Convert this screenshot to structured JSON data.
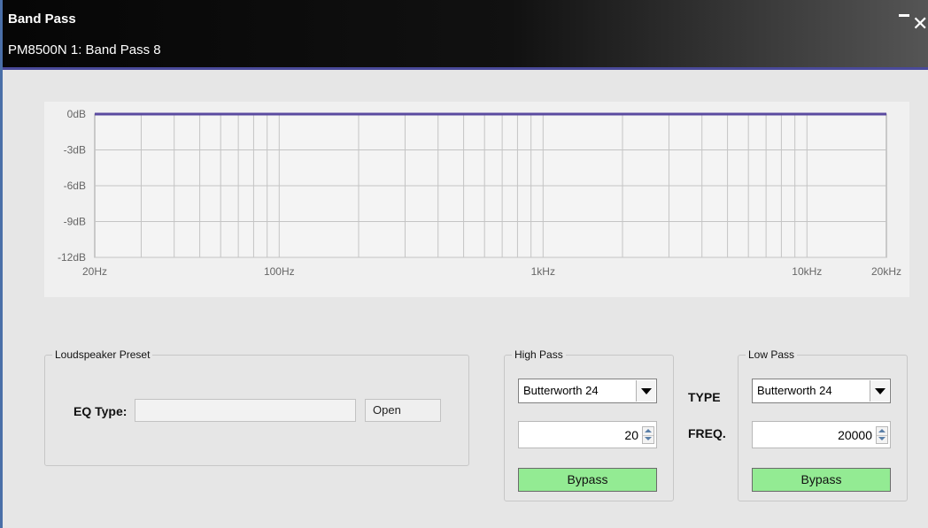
{
  "window": {
    "title": "Band Pass",
    "subtitle": "PM8500N 1: Band Pass 8",
    "minimize_glyph": "_",
    "close_glyph": "✕"
  },
  "graph": {
    "y_labels": [
      "0dB",
      "-3dB",
      "-6dB",
      "-9dB",
      "-12dB"
    ],
    "x_labels": [
      {
        "text": "20Hz",
        "hz": 20
      },
      {
        "text": "100Hz",
        "hz": 100
      },
      {
        "text": "1kHz",
        "hz": 1000
      },
      {
        "text": "10kHz",
        "hz": 10000
      },
      {
        "text": "20kHz",
        "hz": 20000
      }
    ],
    "response_db": 0,
    "curve_color": "#5a4aa0"
  },
  "chart_data": {
    "type": "line",
    "xlabel": "",
    "ylabel": "",
    "x_scale": "log",
    "xlim": [
      20,
      20000
    ],
    "ylim": [
      -12,
      0
    ],
    "x_ticks": [
      "20Hz",
      "100Hz",
      "1kHz",
      "10kHz",
      "20kHz"
    ],
    "y_ticks": [
      "0dB",
      "-3dB",
      "-6dB",
      "-9dB",
      "-12dB"
    ],
    "grid": true,
    "series": [
      {
        "x": [
          20,
          20000
        ],
        "y": [
          0,
          0
        ]
      }
    ]
  },
  "loudspeaker": {
    "legend": "Loudspeaker Preset",
    "eq_type_label": "EQ Type:",
    "eq_type_value": "",
    "open_label": "Open"
  },
  "high_pass": {
    "legend": "High Pass",
    "type": "Butterworth 24",
    "freq": "20",
    "bypass_label": "Bypass"
  },
  "low_pass": {
    "legend": "Low Pass",
    "type": "Butterworth 24",
    "freq": "20000",
    "bypass_label": "Bypass"
  },
  "row_labels": {
    "type": "TYPE",
    "freq": "FREQ."
  },
  "colors": {
    "bypass_active": "#93eb93",
    "title_bar": "#0a0a0a"
  }
}
